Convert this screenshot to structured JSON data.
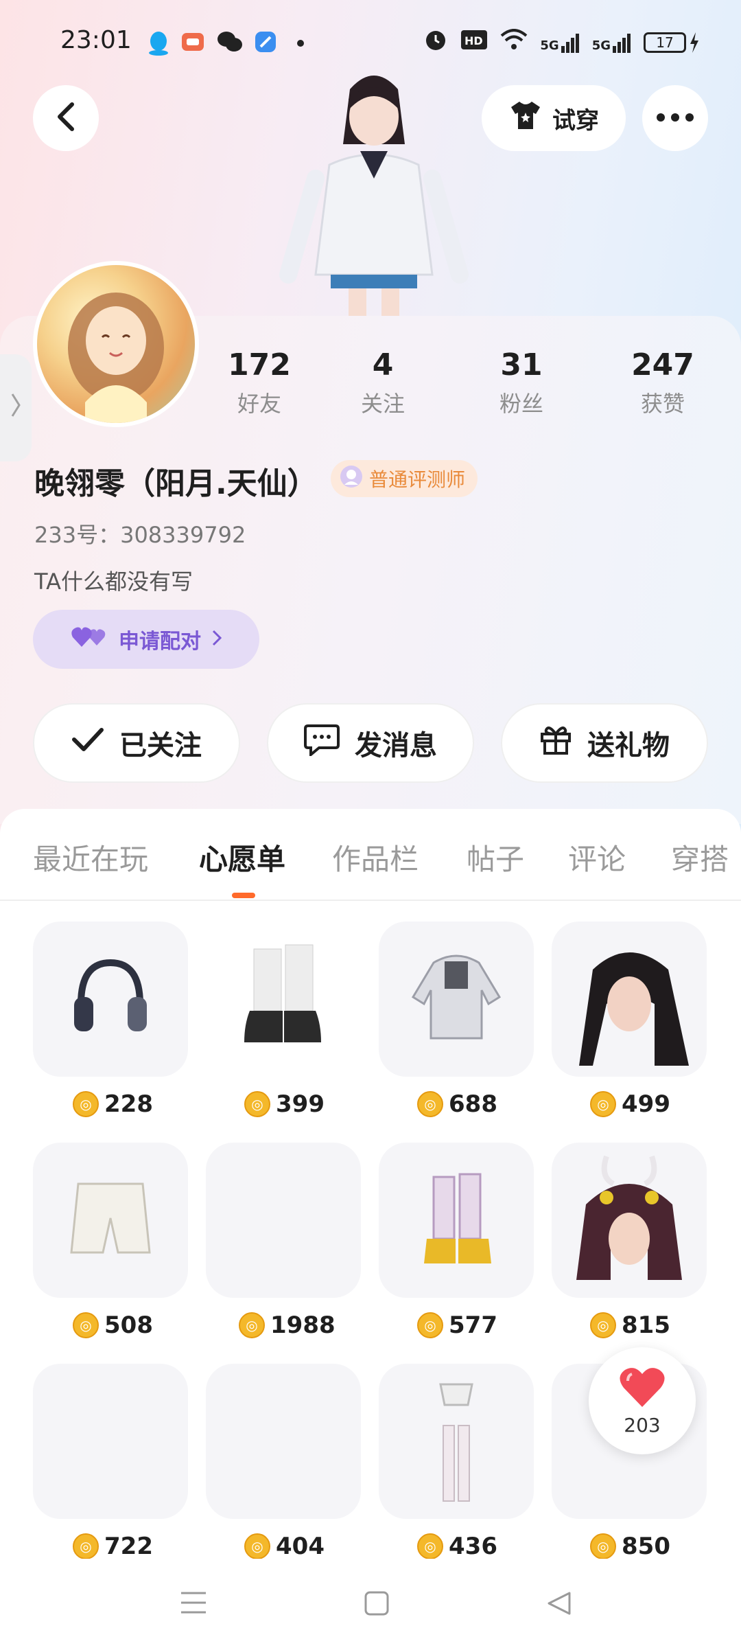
{
  "status_bar": {
    "time": "23:01",
    "network_1": "5G",
    "network_2": "5G",
    "battery": "17"
  },
  "header": {
    "try_on_label": "试穿"
  },
  "profile": {
    "stats": [
      {
        "value": "172",
        "label": "好友"
      },
      {
        "value": "4",
        "label": "关注"
      },
      {
        "value": "31",
        "label": "粉丝"
      },
      {
        "value": "247",
        "label": "获赞"
      }
    ],
    "name": "晚翎零（阳月.天仙）",
    "badge": "普通评测师",
    "uid": "233号：308339792",
    "bio": "TA什么都没有写",
    "pair_label": "申请配对"
  },
  "actions": {
    "follow": "已关注",
    "message": "发消息",
    "gift": "送礼物"
  },
  "tabs": [
    "最近在玩",
    "心愿单",
    "作品栏",
    "帖子",
    "评论",
    "穿搭"
  ],
  "active_tab": "心愿单",
  "wishlist": [
    {
      "item": "headphones",
      "price": "228"
    },
    {
      "item": "boots",
      "price": "399"
    },
    {
      "item": "jacket",
      "price": "688"
    },
    {
      "item": "hair",
      "price": "499"
    },
    {
      "item": "shorts",
      "price": "508"
    },
    {
      "item": "empty",
      "price": "1988"
    },
    {
      "item": "boots-gold",
      "price": "577"
    },
    {
      "item": "hair-horns",
      "price": "815"
    },
    {
      "item": "empty",
      "price": "722"
    },
    {
      "item": "empty",
      "price": "404"
    },
    {
      "item": "stockings",
      "price": "436"
    },
    {
      "item": "empty",
      "price": "850"
    }
  ],
  "like": {
    "count": "203"
  }
}
